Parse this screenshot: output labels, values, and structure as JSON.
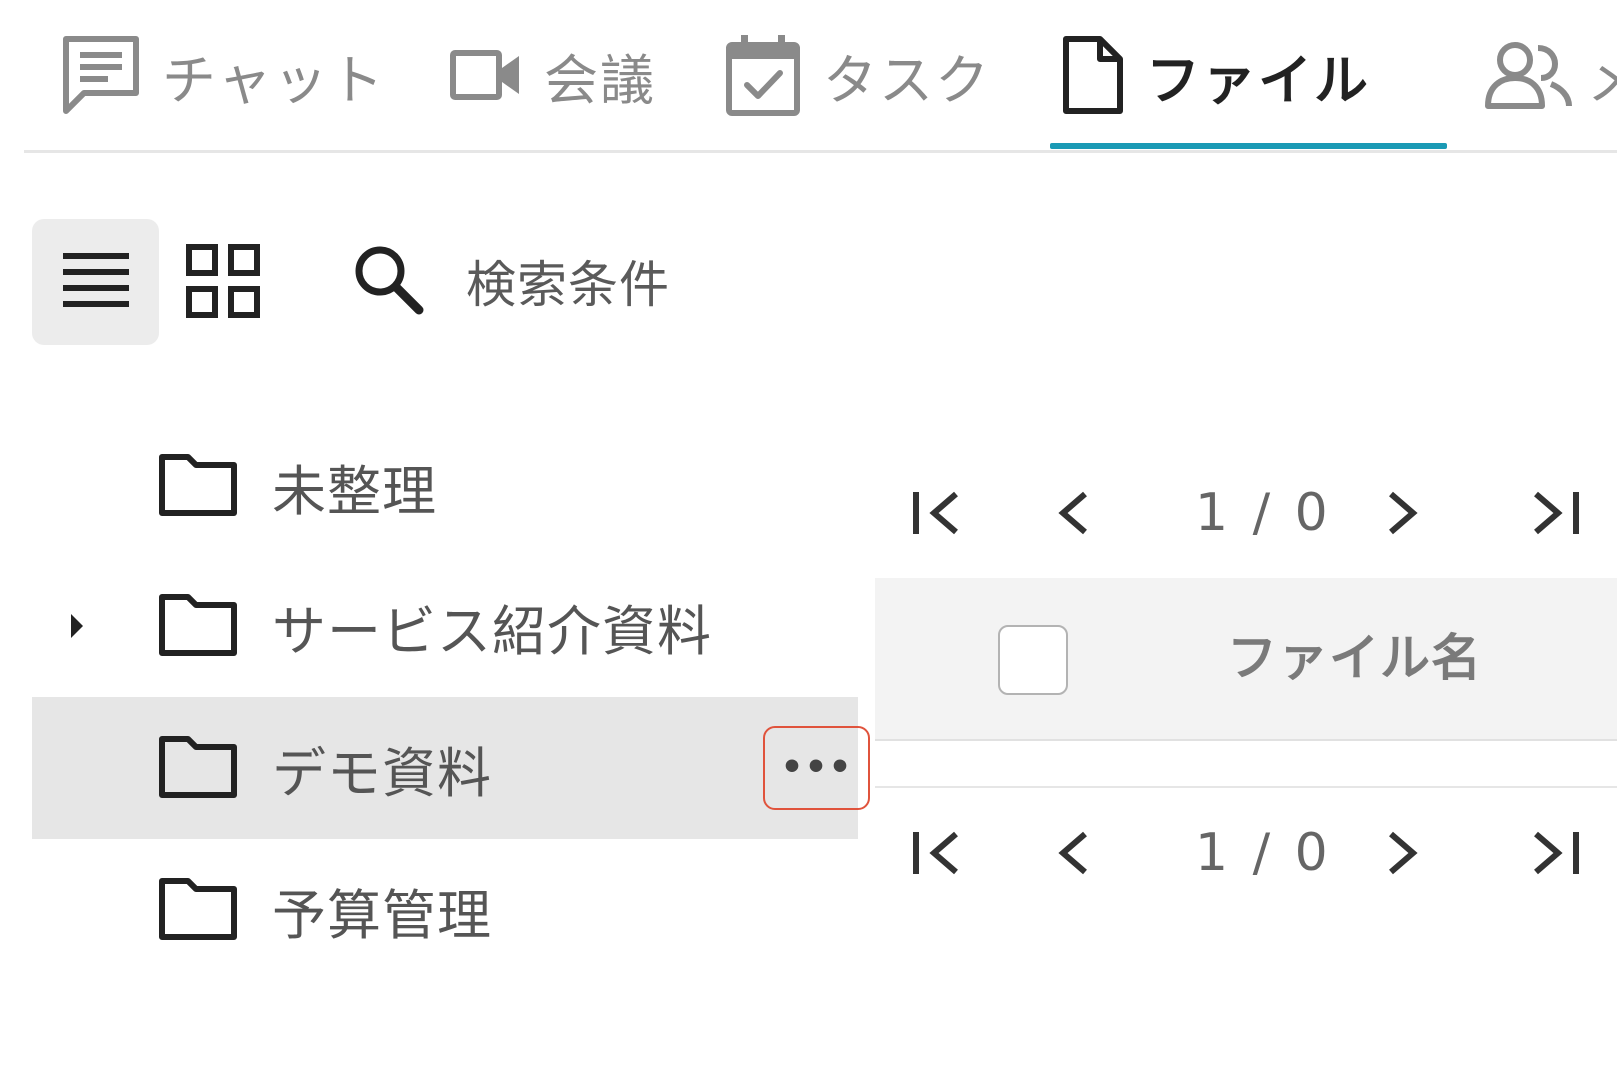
{
  "tabs": [
    {
      "label": "チャット",
      "icon": "chat-icon"
    },
    {
      "label": "会議",
      "icon": "video-icon"
    },
    {
      "label": "タスク",
      "icon": "calendar-check-icon"
    },
    {
      "label": "ファイル",
      "icon": "file-icon",
      "active": true
    },
    {
      "label": "メ",
      "icon": "people-icon"
    }
  ],
  "toolbar": {
    "search_label": "検索条件"
  },
  "folders": [
    {
      "label": "未整理",
      "has_children": false,
      "selected": false
    },
    {
      "label": "サービス紹介資料",
      "has_children": true,
      "selected": false
    },
    {
      "label": "デモ資料",
      "has_children": false,
      "selected": true,
      "more": "•••"
    },
    {
      "label": "予算管理",
      "has_children": false,
      "selected": false
    }
  ],
  "pagination": {
    "top_text": "1 / 0",
    "bottom_text": "1 / 0"
  },
  "table": {
    "columns": [
      "ファイル名"
    ]
  },
  "colors": {
    "accent": "#1a9ab5",
    "highlight_border": "#e0533c",
    "selected_row": "#e6e6e6"
  }
}
